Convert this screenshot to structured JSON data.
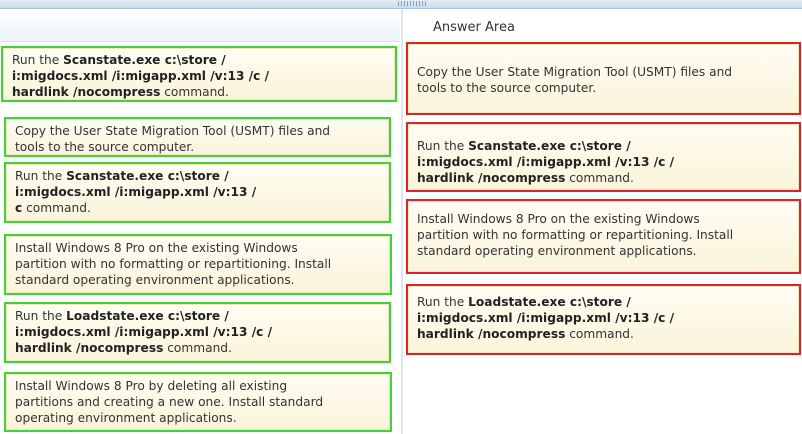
{
  "answer_area": {
    "title": "Answer Area"
  },
  "source_cards": [
    {
      "prefix": "Run the ",
      "bold": "Scanstate.exe c:\\store /\ni:migdocs.xml /i:migapp.xml /v:13 /c /\nhardlink /nocompress",
      "suffix": " command."
    },
    {
      "prefix": "Copy the User State Migration Tool (USMT) files and\ntools to the source computer.",
      "bold": "",
      "suffix": ""
    },
    {
      "prefix": "Run the ",
      "bold": "Scanstate.exe c:\\store /\ni:migdocs.xml /i:migapp.xml /v:13 /\nc",
      "suffix": " command."
    },
    {
      "prefix": "Install Windows 8 Pro on the existing Windows\npartition with no formatting or repartitioning. Install\nstandard operating environment applications.",
      "bold": "",
      "suffix": ""
    },
    {
      "prefix": "Run the ",
      "bold": "Loadstate.exe c:\\store /\ni:migdocs.xml /i:migapp.xml /v:13 /c /\nhardlink /nocompress",
      "suffix": " command."
    },
    {
      "prefix": "Install Windows 8 Pro by deleting all existing\npartitions and creating a new one. Install standard\noperating environment applications.",
      "bold": "",
      "suffix": ""
    }
  ],
  "answer_cards": [
    {
      "prefix": "Copy the User State Migration Tool (USMT) files and\ntools to the source computer.",
      "bold": "",
      "suffix": ""
    },
    {
      "prefix": "Run the ",
      "bold": "Scanstate.exe c:\\store /\ni:migdocs.xml /i:migapp.xml /v:13 /c /\nhardlink /nocompress",
      "suffix": " command."
    },
    {
      "prefix": "Install Windows 8 Pro on the existing Windows\npartition with no formatting or repartitioning. Install\nstandard operating environment applications.",
      "bold": "",
      "suffix": ""
    },
    {
      "prefix": "Run the ",
      "bold": "Loadstate.exe c:\\store /\ni:migdocs.xml /i:migapp.xml /v:13 /c /\nhardlink /nocompress",
      "suffix": " command."
    }
  ],
  "colors": {
    "source_border": "#3ed339",
    "answer_border": "#d9242b",
    "card_fill": "#fbf4da"
  }
}
